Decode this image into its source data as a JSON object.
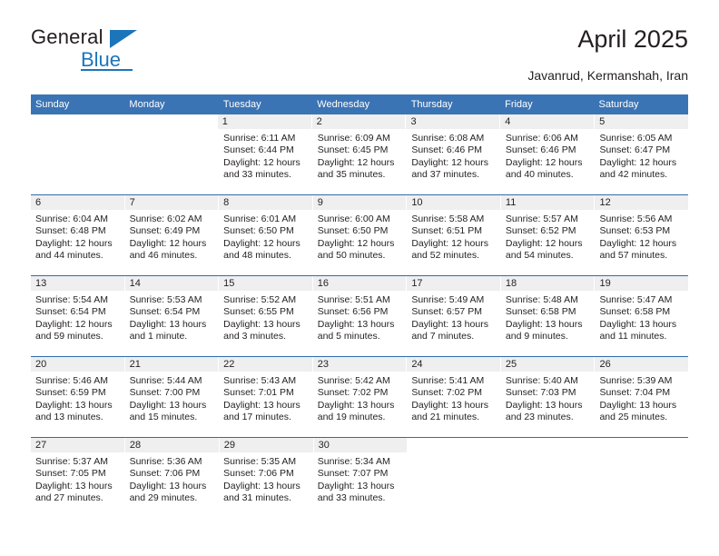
{
  "logo": {
    "primary_text": "General",
    "secondary_text": "Blue",
    "brand_color": "#1b75bb"
  },
  "header": {
    "title": "April 2025",
    "subtitle": "Javanrud, Kermanshah, Iran"
  },
  "calendar": {
    "header_background": "#3b74b4",
    "weekdays": [
      "Sunday",
      "Monday",
      "Tuesday",
      "Wednesday",
      "Thursday",
      "Friday",
      "Saturday"
    ],
    "weeks": [
      [
        {
          "day": "",
          "lines": []
        },
        {
          "day": "",
          "lines": []
        },
        {
          "day": "1",
          "lines": [
            "Sunrise: 6:11 AM",
            "Sunset: 6:44 PM",
            "Daylight: 12 hours",
            "and 33 minutes."
          ]
        },
        {
          "day": "2",
          "lines": [
            "Sunrise: 6:09 AM",
            "Sunset: 6:45 PM",
            "Daylight: 12 hours",
            "and 35 minutes."
          ]
        },
        {
          "day": "3",
          "lines": [
            "Sunrise: 6:08 AM",
            "Sunset: 6:46 PM",
            "Daylight: 12 hours",
            "and 37 minutes."
          ]
        },
        {
          "day": "4",
          "lines": [
            "Sunrise: 6:06 AM",
            "Sunset: 6:46 PM",
            "Daylight: 12 hours",
            "and 40 minutes."
          ]
        },
        {
          "day": "5",
          "lines": [
            "Sunrise: 6:05 AM",
            "Sunset: 6:47 PM",
            "Daylight: 12 hours",
            "and 42 minutes."
          ]
        }
      ],
      [
        {
          "day": "6",
          "lines": [
            "Sunrise: 6:04 AM",
            "Sunset: 6:48 PM",
            "Daylight: 12 hours",
            "and 44 minutes."
          ]
        },
        {
          "day": "7",
          "lines": [
            "Sunrise: 6:02 AM",
            "Sunset: 6:49 PM",
            "Daylight: 12 hours",
            "and 46 minutes."
          ]
        },
        {
          "day": "8",
          "lines": [
            "Sunrise: 6:01 AM",
            "Sunset: 6:50 PM",
            "Daylight: 12 hours",
            "and 48 minutes."
          ]
        },
        {
          "day": "9",
          "lines": [
            "Sunrise: 6:00 AM",
            "Sunset: 6:50 PM",
            "Daylight: 12 hours",
            "and 50 minutes."
          ]
        },
        {
          "day": "10",
          "lines": [
            "Sunrise: 5:58 AM",
            "Sunset: 6:51 PM",
            "Daylight: 12 hours",
            "and 52 minutes."
          ]
        },
        {
          "day": "11",
          "lines": [
            "Sunrise: 5:57 AM",
            "Sunset: 6:52 PM",
            "Daylight: 12 hours",
            "and 54 minutes."
          ]
        },
        {
          "day": "12",
          "lines": [
            "Sunrise: 5:56 AM",
            "Sunset: 6:53 PM",
            "Daylight: 12 hours",
            "and 57 minutes."
          ]
        }
      ],
      [
        {
          "day": "13",
          "lines": [
            "Sunrise: 5:54 AM",
            "Sunset: 6:54 PM",
            "Daylight: 12 hours",
            "and 59 minutes."
          ]
        },
        {
          "day": "14",
          "lines": [
            "Sunrise: 5:53 AM",
            "Sunset: 6:54 PM",
            "Daylight: 13 hours",
            "and 1 minute."
          ]
        },
        {
          "day": "15",
          "lines": [
            "Sunrise: 5:52 AM",
            "Sunset: 6:55 PM",
            "Daylight: 13 hours",
            "and 3 minutes."
          ]
        },
        {
          "day": "16",
          "lines": [
            "Sunrise: 5:51 AM",
            "Sunset: 6:56 PM",
            "Daylight: 13 hours",
            "and 5 minutes."
          ]
        },
        {
          "day": "17",
          "lines": [
            "Sunrise: 5:49 AM",
            "Sunset: 6:57 PM",
            "Daylight: 13 hours",
            "and 7 minutes."
          ]
        },
        {
          "day": "18",
          "lines": [
            "Sunrise: 5:48 AM",
            "Sunset: 6:58 PM",
            "Daylight: 13 hours",
            "and 9 minutes."
          ]
        },
        {
          "day": "19",
          "lines": [
            "Sunrise: 5:47 AM",
            "Sunset: 6:58 PM",
            "Daylight: 13 hours",
            "and 11 minutes."
          ]
        }
      ],
      [
        {
          "day": "20",
          "lines": [
            "Sunrise: 5:46 AM",
            "Sunset: 6:59 PM",
            "Daylight: 13 hours",
            "and 13 minutes."
          ]
        },
        {
          "day": "21",
          "lines": [
            "Sunrise: 5:44 AM",
            "Sunset: 7:00 PM",
            "Daylight: 13 hours",
            "and 15 minutes."
          ]
        },
        {
          "day": "22",
          "lines": [
            "Sunrise: 5:43 AM",
            "Sunset: 7:01 PM",
            "Daylight: 13 hours",
            "and 17 minutes."
          ]
        },
        {
          "day": "23",
          "lines": [
            "Sunrise: 5:42 AM",
            "Sunset: 7:02 PM",
            "Daylight: 13 hours",
            "and 19 minutes."
          ]
        },
        {
          "day": "24",
          "lines": [
            "Sunrise: 5:41 AM",
            "Sunset: 7:02 PM",
            "Daylight: 13 hours",
            "and 21 minutes."
          ]
        },
        {
          "day": "25",
          "lines": [
            "Sunrise: 5:40 AM",
            "Sunset: 7:03 PM",
            "Daylight: 13 hours",
            "and 23 minutes."
          ]
        },
        {
          "day": "26",
          "lines": [
            "Sunrise: 5:39 AM",
            "Sunset: 7:04 PM",
            "Daylight: 13 hours",
            "and 25 minutes."
          ]
        }
      ],
      [
        {
          "day": "27",
          "lines": [
            "Sunrise: 5:37 AM",
            "Sunset: 7:05 PM",
            "Daylight: 13 hours",
            "and 27 minutes."
          ]
        },
        {
          "day": "28",
          "lines": [
            "Sunrise: 5:36 AM",
            "Sunset: 7:06 PM",
            "Daylight: 13 hours",
            "and 29 minutes."
          ]
        },
        {
          "day": "29",
          "lines": [
            "Sunrise: 5:35 AM",
            "Sunset: 7:06 PM",
            "Daylight: 13 hours",
            "and 31 minutes."
          ]
        },
        {
          "day": "30",
          "lines": [
            "Sunrise: 5:34 AM",
            "Sunset: 7:07 PM",
            "Daylight: 13 hours",
            "and 33 minutes."
          ]
        },
        {
          "day": "",
          "lines": []
        },
        {
          "day": "",
          "lines": []
        },
        {
          "day": "",
          "lines": []
        }
      ]
    ]
  }
}
